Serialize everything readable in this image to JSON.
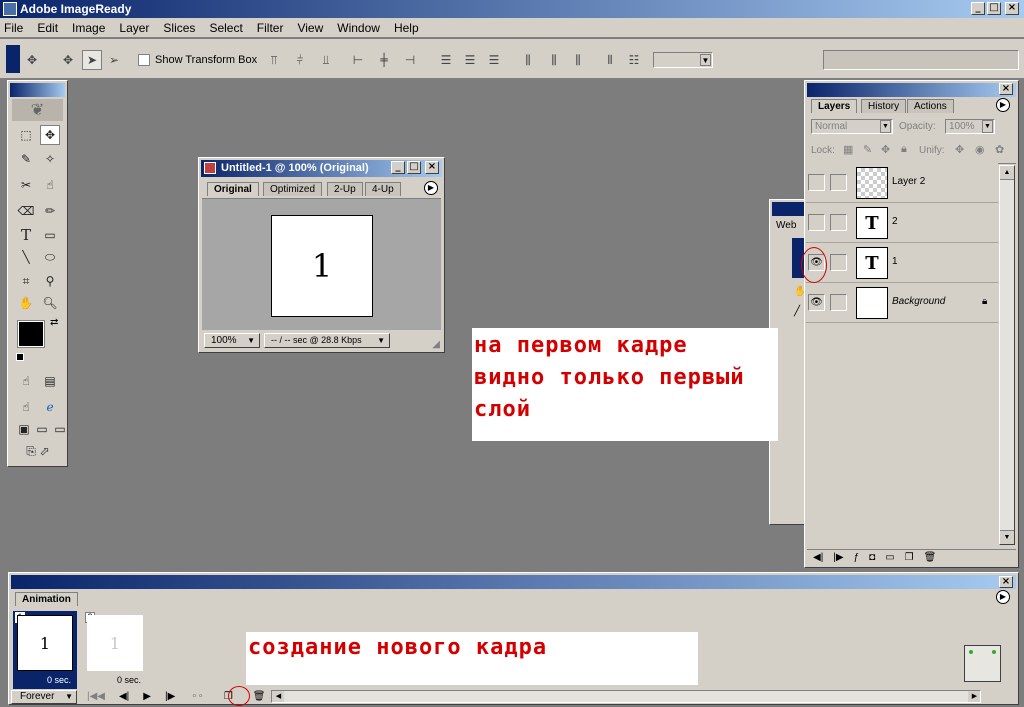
{
  "app": {
    "title": "Adobe ImageReady"
  },
  "menu": [
    "File",
    "Edit",
    "Image",
    "Layer",
    "Slices",
    "Select",
    "Filter",
    "View",
    "Window",
    "Help"
  ],
  "options_bar": {
    "show_transform_box": "Show Transform Box"
  },
  "doc": {
    "title": "Untitled-1 @ 100% (Original)",
    "tabs": [
      "Original",
      "Optimized",
      "2-Up",
      "4-Up"
    ],
    "canvas_text": "1",
    "zoom": "100%",
    "status": "-- / -- sec @ 28.8 Kbps"
  },
  "bg_palette": {
    "tab": "Web"
  },
  "layers_panel": {
    "tabs": [
      "Layers",
      "History",
      "Actions"
    ],
    "blend_mode": "Normal",
    "opacity_label": "Opacity:",
    "opacity_value": "100%",
    "lock_label": "Lock:",
    "unify_label": "Unify:",
    "layers": [
      {
        "name": "Layer 2",
        "thumb": "",
        "visible": false
      },
      {
        "name": "2",
        "thumb": "T",
        "visible": false
      },
      {
        "name": "1",
        "thumb": "T",
        "visible": true
      },
      {
        "name": "Background",
        "thumb": "",
        "visible": true
      }
    ]
  },
  "annotations": {
    "layers_note": [
      "на первом кадре",
      "видно только первый",
      "слой"
    ],
    "frame_note": "создание нового кадра"
  },
  "animation": {
    "tab": "Animation",
    "frames": [
      {
        "number": "1",
        "content": "1",
        "delay": "0 sec."
      },
      {
        "number": "2",
        "content": "1",
        "delay": "0 sec."
      }
    ],
    "loop": "Forever"
  }
}
